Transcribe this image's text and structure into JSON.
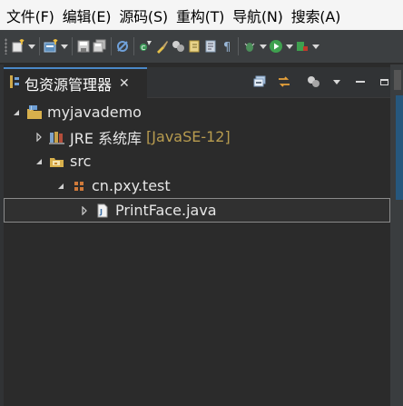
{
  "menu": [
    {
      "id": "file",
      "label": "文件(F)"
    },
    {
      "id": "edit",
      "label": "编辑(E)"
    },
    {
      "id": "source",
      "label": "源码(S)"
    },
    {
      "id": "refactor",
      "label": "重构(T)"
    },
    {
      "id": "navigate",
      "label": "导航(N)"
    },
    {
      "id": "search",
      "label": "搜索(A)"
    }
  ],
  "view": {
    "title": "包资源管理器",
    "close_glyph": "✕"
  },
  "tree": {
    "project": "myjavademo",
    "jre_label": "JRE 系统库",
    "jre_decoration": "[JavaSE-12]",
    "src_folder": "src",
    "package": "cn.pxy.test",
    "file": "PrintFace.java"
  },
  "colors": {
    "accent": "#4a88c7",
    "selection_border": "#8a8a8a",
    "decoration": "#b89c4f",
    "background": "#2b2b2b"
  }
}
